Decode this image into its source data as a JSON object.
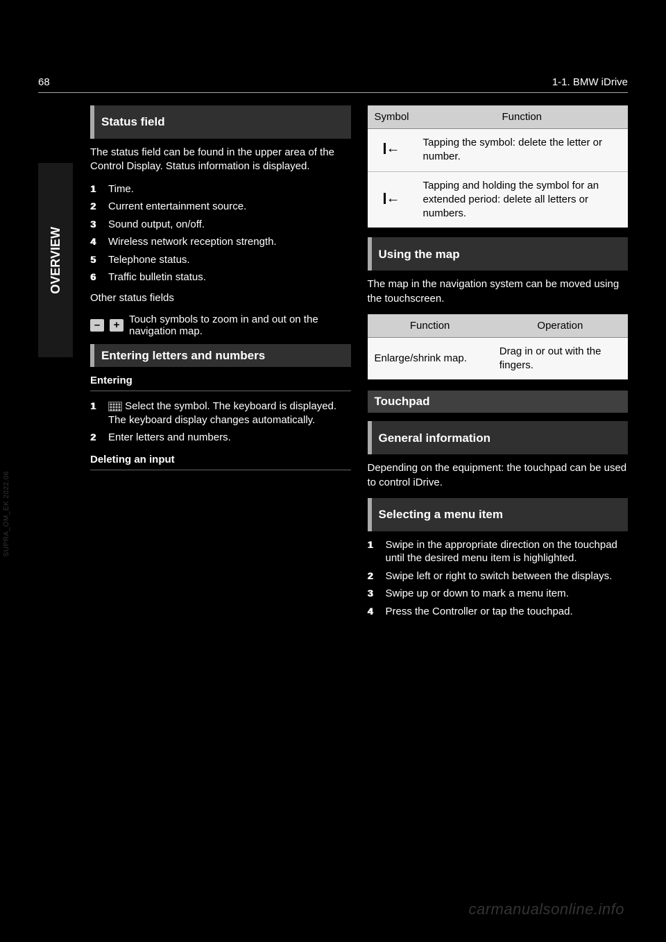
{
  "header": {
    "page_number": "68",
    "title": "1-1. BMW iDrive"
  },
  "side_tab": "OVERVIEW",
  "left": {
    "sec1_title": "Status field",
    "sec1_text": "The status field can be found in the upper area of the Control Display. Status information is displayed.",
    "status_items": [
      "Time.",
      "Current entertainment source.",
      "Sound output, on/off.",
      "Wireless network reception strength.",
      "Telephone status.",
      "Traffic bulletin status."
    ],
    "sec1_tail": "Other status fields",
    "symbol_row_text": "Touch symbols to zoom in and out on the navigation map.",
    "sec2_title": "Entering letters and numbers",
    "sub_entering": "Entering",
    "entering_steps": [
      {
        "icon": true,
        "text": " Select the symbol. The keyboard is displayed. The keyboard display changes automatically."
      },
      {
        "icon": false,
        "text": "Enter letters and numbers."
      }
    ],
    "deleting_sub": "Deleting an input"
  },
  "right": {
    "table1_headers": [
      "Symbol",
      "Function"
    ],
    "table1_rows": [
      "Tapping the symbol: delete the letter or number.",
      "Tapping and holding the symbol for an extended period: delete all letters or numbers."
    ],
    "sec_a_title": "Using the map",
    "sec_a_text": "The map in the navigation system can be moved using the touchscreen.",
    "table2_headers": [
      "Function",
      "Operation"
    ],
    "table2_row": {
      "func": "Enlarge/shrink map.",
      "op": "Drag in or out with the fingers."
    },
    "sub_touchpad": "Touchpad",
    "sec_b_title": "General information",
    "sec_b_text": "Depending on the equipment: the touchpad can be used to control iDrive.",
    "sec_c_title": "Selecting a menu item",
    "menu_steps": [
      "Swipe in the appropriate direction on the touchpad until the desired menu item is highlighted.",
      "Swipe left or right to switch between the displays.",
      "Swipe up or down to mark a menu item.",
      "Press the Controller or tap the touchpad."
    ]
  },
  "watermark": "carmanualsonline.info",
  "src_note": "SUPRA_OM_EK 2022.06"
}
